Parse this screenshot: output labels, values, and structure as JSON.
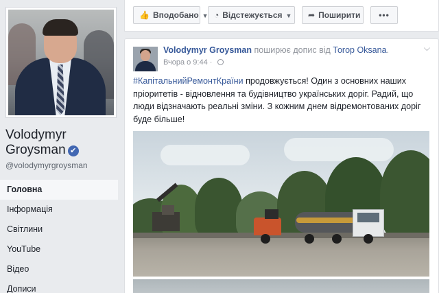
{
  "profile": {
    "name": "Volodymyr Groysman",
    "handle": "@volodymyrgroysman",
    "verified_mark": "✔"
  },
  "nav": {
    "items": [
      {
        "label": "Головна",
        "active": true
      },
      {
        "label": "Інформація",
        "active": false
      },
      {
        "label": "Світлини",
        "active": false
      },
      {
        "label": "YouTube",
        "active": false
      },
      {
        "label": "Відео",
        "active": false
      },
      {
        "label": "Дописи",
        "active": false
      }
    ]
  },
  "actions": {
    "liked_label": "Вподобано",
    "follow_label": "Відстежується",
    "share_label": "Поширити",
    "more_label": "•••",
    "icons": {
      "liked": "thumbs-up-icon",
      "follow": "rss-icon",
      "share": "share-arrow-icon",
      "caret": "caret-down-icon"
    }
  },
  "post": {
    "author": "Volodymyr Groysman",
    "share_text": "поширює допис від",
    "shared_from": "Тоrор Oksana",
    "period": ".",
    "time": "Вчора о 9:44",
    "separator": "·",
    "hashtag": "#КапітальнийРемонтКраїни",
    "body": " продовжується! Один з основних наших пріоритетів - відновлення та будівництво українських доріг. Радий, що люди відзначають реальні зміни. З кожним днем відремонтованих доріг буде більше!",
    "menu": "⌵"
  },
  "colors": {
    "link": "#365899",
    "background": "#e9ebee",
    "text": "#1d2129",
    "meta": "#90949c"
  }
}
